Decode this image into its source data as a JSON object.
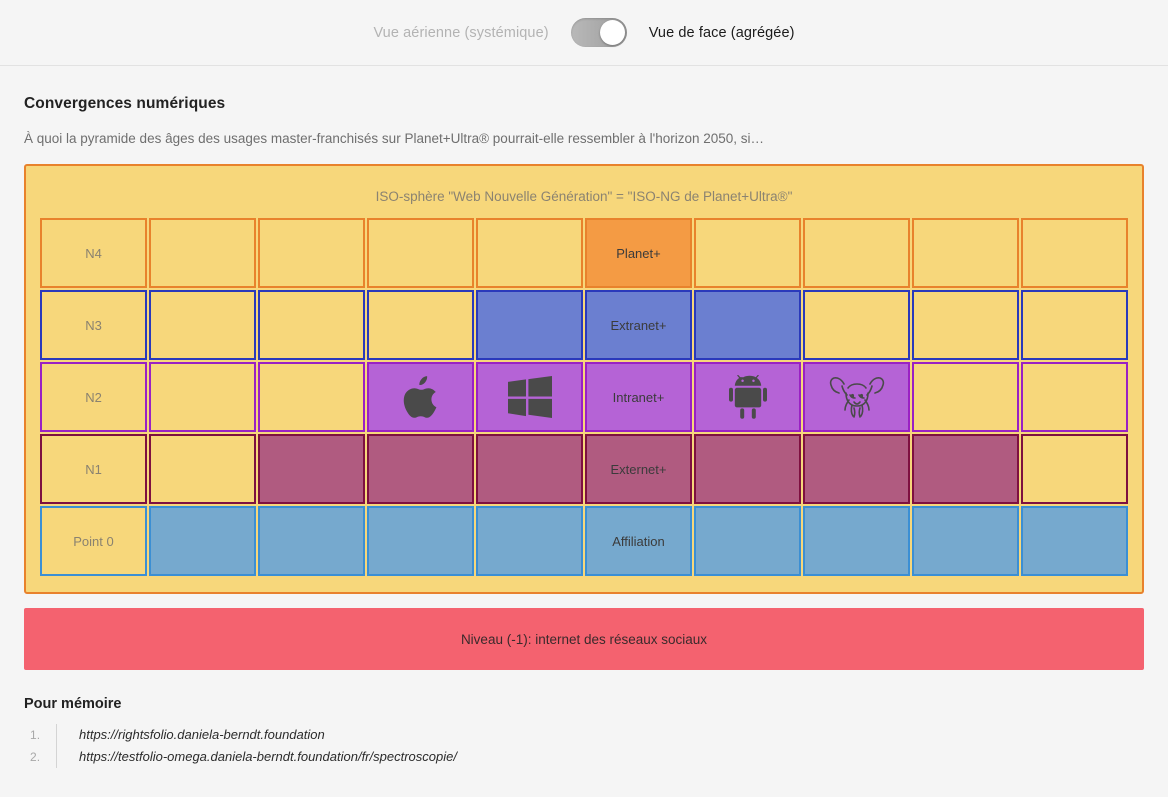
{
  "toggle": {
    "left_label": "Vue aérienne (systémique)",
    "right_label": "Vue de face (agrégée)",
    "state": "right"
  },
  "section": {
    "title": "Convergences numériques",
    "subtitle": "À quoi la pyramide des âges des usages master-franchisés sur Planet+Ultra® pourrait-elle ressembler à l'horizon 2050, si…"
  },
  "iso_box": {
    "title": "ISO-sphère \"Web Nouvelle Génération\" = \"ISO-NG de Planet+Ultra®\"",
    "border_color": "#e8822c",
    "background": "#f7d77b"
  },
  "grid": {
    "columns": 10,
    "rows": [
      {
        "id": "n4",
        "axis_label": "N4",
        "accent": "#e8822c",
        "cells": [
          {
            "label": "N4",
            "fill": "none",
            "icon": ""
          },
          {
            "label": "",
            "fill": "none",
            "icon": ""
          },
          {
            "label": "",
            "fill": "none",
            "icon": ""
          },
          {
            "label": "",
            "fill": "none",
            "icon": ""
          },
          {
            "label": "",
            "fill": "none",
            "icon": ""
          },
          {
            "label": "Planet+",
            "fill": "orange",
            "icon": ""
          },
          {
            "label": "",
            "fill": "none",
            "icon": ""
          },
          {
            "label": "",
            "fill": "none",
            "icon": ""
          },
          {
            "label": "",
            "fill": "none",
            "icon": ""
          },
          {
            "label": "",
            "fill": "none",
            "icon": ""
          }
        ]
      },
      {
        "id": "n3",
        "axis_label": "N3",
        "accent": "#2a39bb",
        "cells": [
          {
            "label": "N3",
            "fill": "none",
            "icon": ""
          },
          {
            "label": "",
            "fill": "none",
            "icon": ""
          },
          {
            "label": "",
            "fill": "none",
            "icon": ""
          },
          {
            "label": "",
            "fill": "none",
            "icon": ""
          },
          {
            "label": "",
            "fill": "blue",
            "icon": ""
          },
          {
            "label": "Extranet+",
            "fill": "blue",
            "icon": ""
          },
          {
            "label": "",
            "fill": "blue",
            "icon": ""
          },
          {
            "label": "",
            "fill": "none",
            "icon": ""
          },
          {
            "label": "",
            "fill": "none",
            "icon": ""
          },
          {
            "label": "",
            "fill": "none",
            "icon": ""
          }
        ]
      },
      {
        "id": "n2",
        "axis_label": "N2",
        "accent": "#9a21c4",
        "cells": [
          {
            "label": "N2",
            "fill": "none",
            "icon": ""
          },
          {
            "label": "",
            "fill": "none",
            "icon": ""
          },
          {
            "label": "",
            "fill": "none",
            "icon": ""
          },
          {
            "label": "",
            "fill": "purple",
            "icon": "apple-logo-icon"
          },
          {
            "label": "",
            "fill": "purple",
            "icon": "windows-logo-icon"
          },
          {
            "label": "Intranet+",
            "fill": "purple",
            "icon": ""
          },
          {
            "label": "",
            "fill": "purple",
            "icon": "android-logo-icon"
          },
          {
            "label": "",
            "fill": "purple",
            "icon": "gnu-logo-icon"
          },
          {
            "label": "",
            "fill": "none",
            "icon": ""
          },
          {
            "label": "",
            "fill": "none",
            "icon": ""
          }
        ]
      },
      {
        "id": "n1",
        "axis_label": "N1",
        "accent": "#7e1040",
        "cells": [
          {
            "label": "N1",
            "fill": "none",
            "icon": ""
          },
          {
            "label": "",
            "fill": "none",
            "icon": ""
          },
          {
            "label": "",
            "fill": "maroon",
            "icon": ""
          },
          {
            "label": "",
            "fill": "maroon",
            "icon": ""
          },
          {
            "label": "",
            "fill": "maroon",
            "icon": ""
          },
          {
            "label": "Externet+",
            "fill": "maroon",
            "icon": ""
          },
          {
            "label": "",
            "fill": "maroon",
            "icon": ""
          },
          {
            "label": "",
            "fill": "maroon",
            "icon": ""
          },
          {
            "label": "",
            "fill": "maroon",
            "icon": ""
          },
          {
            "label": "",
            "fill": "none",
            "icon": ""
          }
        ]
      },
      {
        "id": "p0",
        "axis_label": "Point 0",
        "accent": "#3b8fd4",
        "cells": [
          {
            "label": "Point 0",
            "fill": "none",
            "icon": ""
          },
          {
            "label": "",
            "fill": "steel",
            "icon": ""
          },
          {
            "label": "",
            "fill": "steel",
            "icon": ""
          },
          {
            "label": "",
            "fill": "steel",
            "icon": ""
          },
          {
            "label": "",
            "fill": "steel",
            "icon": ""
          },
          {
            "label": "Affiliation",
            "fill": "steel",
            "icon": ""
          },
          {
            "label": "",
            "fill": "steel",
            "icon": ""
          },
          {
            "label": "",
            "fill": "steel",
            "icon": ""
          },
          {
            "label": "",
            "fill": "steel",
            "icon": ""
          },
          {
            "label": "",
            "fill": "steel",
            "icon": ""
          }
        ]
      }
    ]
  },
  "banner": {
    "text": "Niveau (-1): internet des réseaux sociaux",
    "color": "#f4626f"
  },
  "footer": {
    "title": "Pour mémoire",
    "references": [
      "https://rightsfolio.daniela-berndt.foundation",
      "https://testfolio-omega.daniela-berndt.foundation/fr/spectroscopie/"
    ]
  }
}
